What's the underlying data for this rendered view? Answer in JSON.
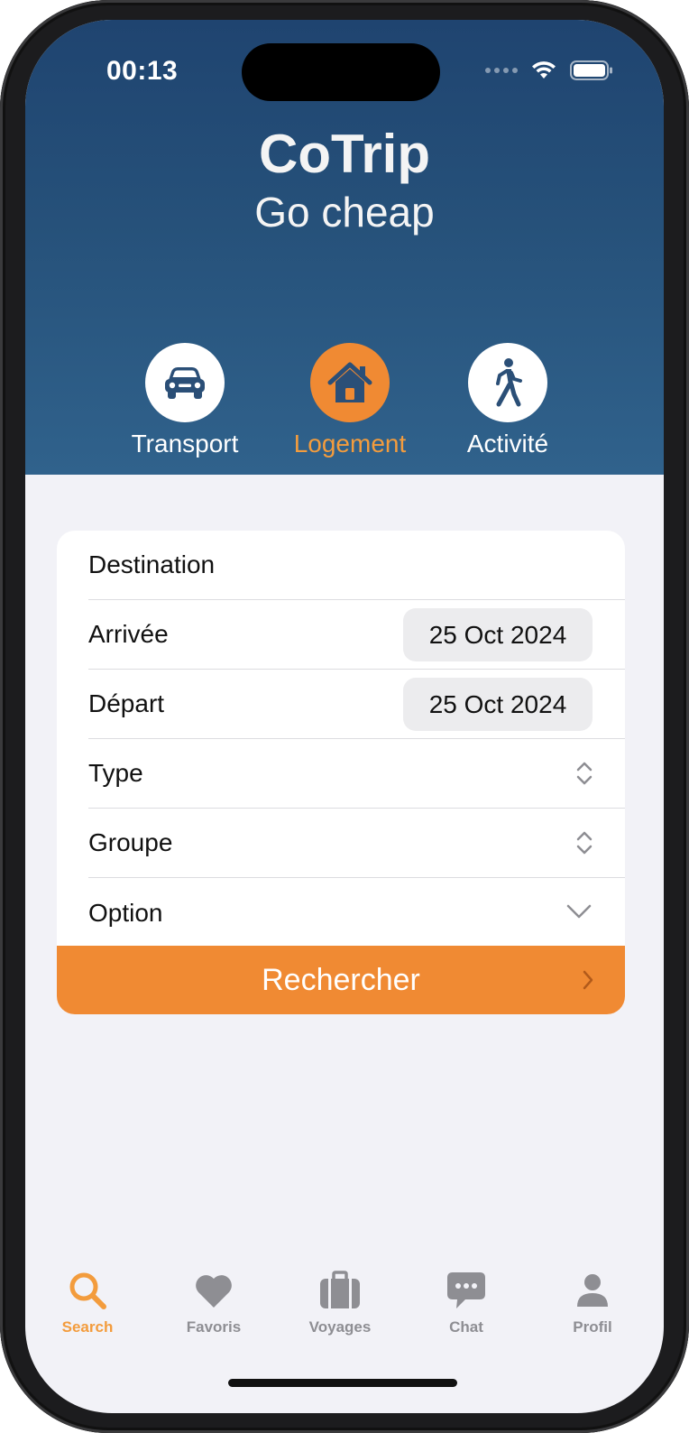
{
  "status_bar": {
    "time": "00:13"
  },
  "header": {
    "title": "CoTrip",
    "subtitle": "Go cheap"
  },
  "categories": [
    {
      "label": "Transport",
      "icon": "car-icon",
      "active": false
    },
    {
      "label": "Logement",
      "icon": "house-icon",
      "active": true
    },
    {
      "label": "Activité",
      "icon": "walking-person-icon",
      "active": false
    }
  ],
  "form": {
    "destination_label": "Destination",
    "arrival_label": "Arrivée",
    "arrival_date": "25 Oct 2024",
    "departure_label": "Départ",
    "departure_date": "25 Oct 2024",
    "type_label": "Type",
    "group_label": "Groupe",
    "option_label": "Option",
    "search_label": "Rechercher"
  },
  "tabbar": {
    "items": [
      {
        "label": "Search",
        "icon": "search-icon",
        "active": true
      },
      {
        "label": "Favoris",
        "icon": "heart-icon",
        "active": false
      },
      {
        "label": "Voyages",
        "icon": "suitcase-icon",
        "active": false
      },
      {
        "label": "Chat",
        "icon": "chat-bubble-icon",
        "active": false
      },
      {
        "label": "Profil",
        "icon": "person-icon",
        "active": false
      }
    ]
  },
  "colors": {
    "accent": "#f08a33",
    "header_top": "#1f4470",
    "header_bottom": "#30628c",
    "inactive": "#8e8e93"
  }
}
